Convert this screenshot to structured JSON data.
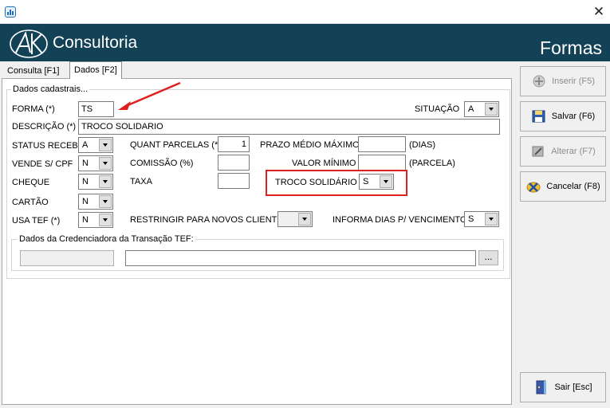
{
  "window": {
    "close_glyph": "✕"
  },
  "header": {
    "brand": "Consultoria",
    "title": "Formas"
  },
  "tabs": [
    {
      "label": "Consulta [F1]"
    },
    {
      "label": "Dados [F2]"
    }
  ],
  "form": {
    "group_title": "Dados cadastrais...",
    "forma": {
      "label": "FORMA (*)",
      "value": "TS"
    },
    "situacao": {
      "label": "SITUAÇÃO",
      "value": "A"
    },
    "descricao": {
      "label": "DESCRIÇÃO (*)",
      "value": "TROCO SOLIDARIO"
    },
    "status_receb": {
      "label": "STATUS RECEB.",
      "value": "A"
    },
    "quant_parcelas": {
      "label": "QUANT PARCELAS (*)",
      "value": "1"
    },
    "prazo_medio": {
      "label": "PRAZO MÉDIO MÁXIMO",
      "value": "",
      "suffix": "(DIAS)"
    },
    "vende_cpf": {
      "label": "VENDE S/ CPF",
      "value": "N"
    },
    "comissao": {
      "label": "COMISSÃO (%)",
      "value": ""
    },
    "valor_minimo": {
      "label": "VALOR MÍNIMO",
      "value": "",
      "suffix": "(PARCELA)"
    },
    "cheque": {
      "label": "CHEQUE",
      "value": "N"
    },
    "taxa": {
      "label": "TAXA",
      "value": ""
    },
    "troco_solidario": {
      "label": "TROCO SOLIDÁRIO",
      "value": "S"
    },
    "cartao": {
      "label": "CARTÃO",
      "value": "N"
    },
    "usa_tef": {
      "label": "USA TEF (*)",
      "value": "N"
    },
    "restringir": {
      "label": "RESTRINGIR PARA NOVOS CLIENTES",
      "value": ""
    },
    "informa_dias": {
      "label": "INFORMA DIAS P/ VENCIMENTO",
      "value": "S"
    },
    "tef": {
      "group_title": "Dados da Credenciadora da Transação TEF:",
      "code": "",
      "name": "",
      "browse_label": "..."
    }
  },
  "buttons": {
    "inserir": {
      "label": "Inserir (F5)",
      "enabled": false
    },
    "salvar": {
      "label": "Salvar (F6)",
      "enabled": true
    },
    "alterar": {
      "label": "Alterar (F7)",
      "enabled": false
    },
    "cancelar": {
      "label": "Cancelar (F8)",
      "enabled": true
    },
    "sair": {
      "label": "Sair [Esc]",
      "enabled": true
    }
  },
  "colors": {
    "header_bg": "#134156",
    "annotation": "#e02020"
  }
}
